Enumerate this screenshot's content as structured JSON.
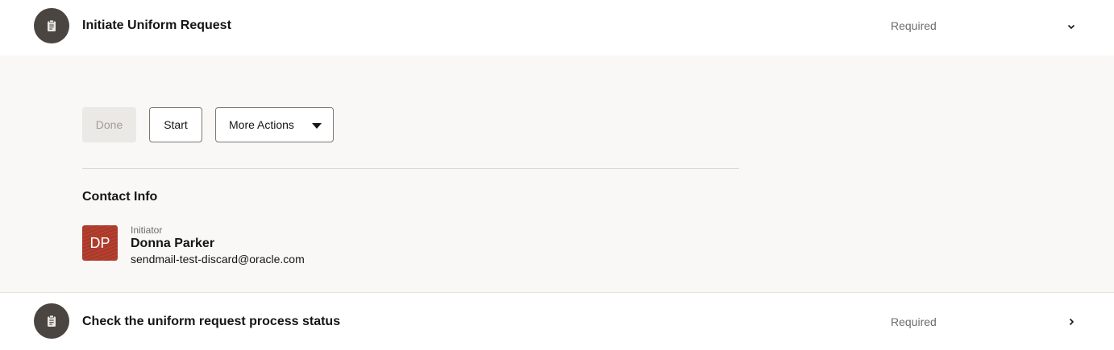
{
  "tasks": [
    {
      "icon": "clipboard-icon",
      "title": "Initiate Uniform Request",
      "status": "Required",
      "toggle_icon": "chevron-down-icon",
      "expanded": true
    },
    {
      "icon": "clipboard-icon",
      "title": "Check the uniform request process status",
      "status": "Required",
      "toggle_icon": "chevron-right-icon",
      "expanded": false
    }
  ],
  "actions": {
    "done_label": "Done",
    "start_label": "Start",
    "more_label": "More Actions"
  },
  "contact": {
    "heading": "Contact Info",
    "initials": "DP",
    "role": "Initiator",
    "name": "Donna Parker",
    "email": "sendmail-test-discard@oracle.com"
  },
  "colors": {
    "panel_background": "#f9f8f6",
    "avatar_background": "#b03a2b",
    "task_icon_background": "#4a4540"
  }
}
